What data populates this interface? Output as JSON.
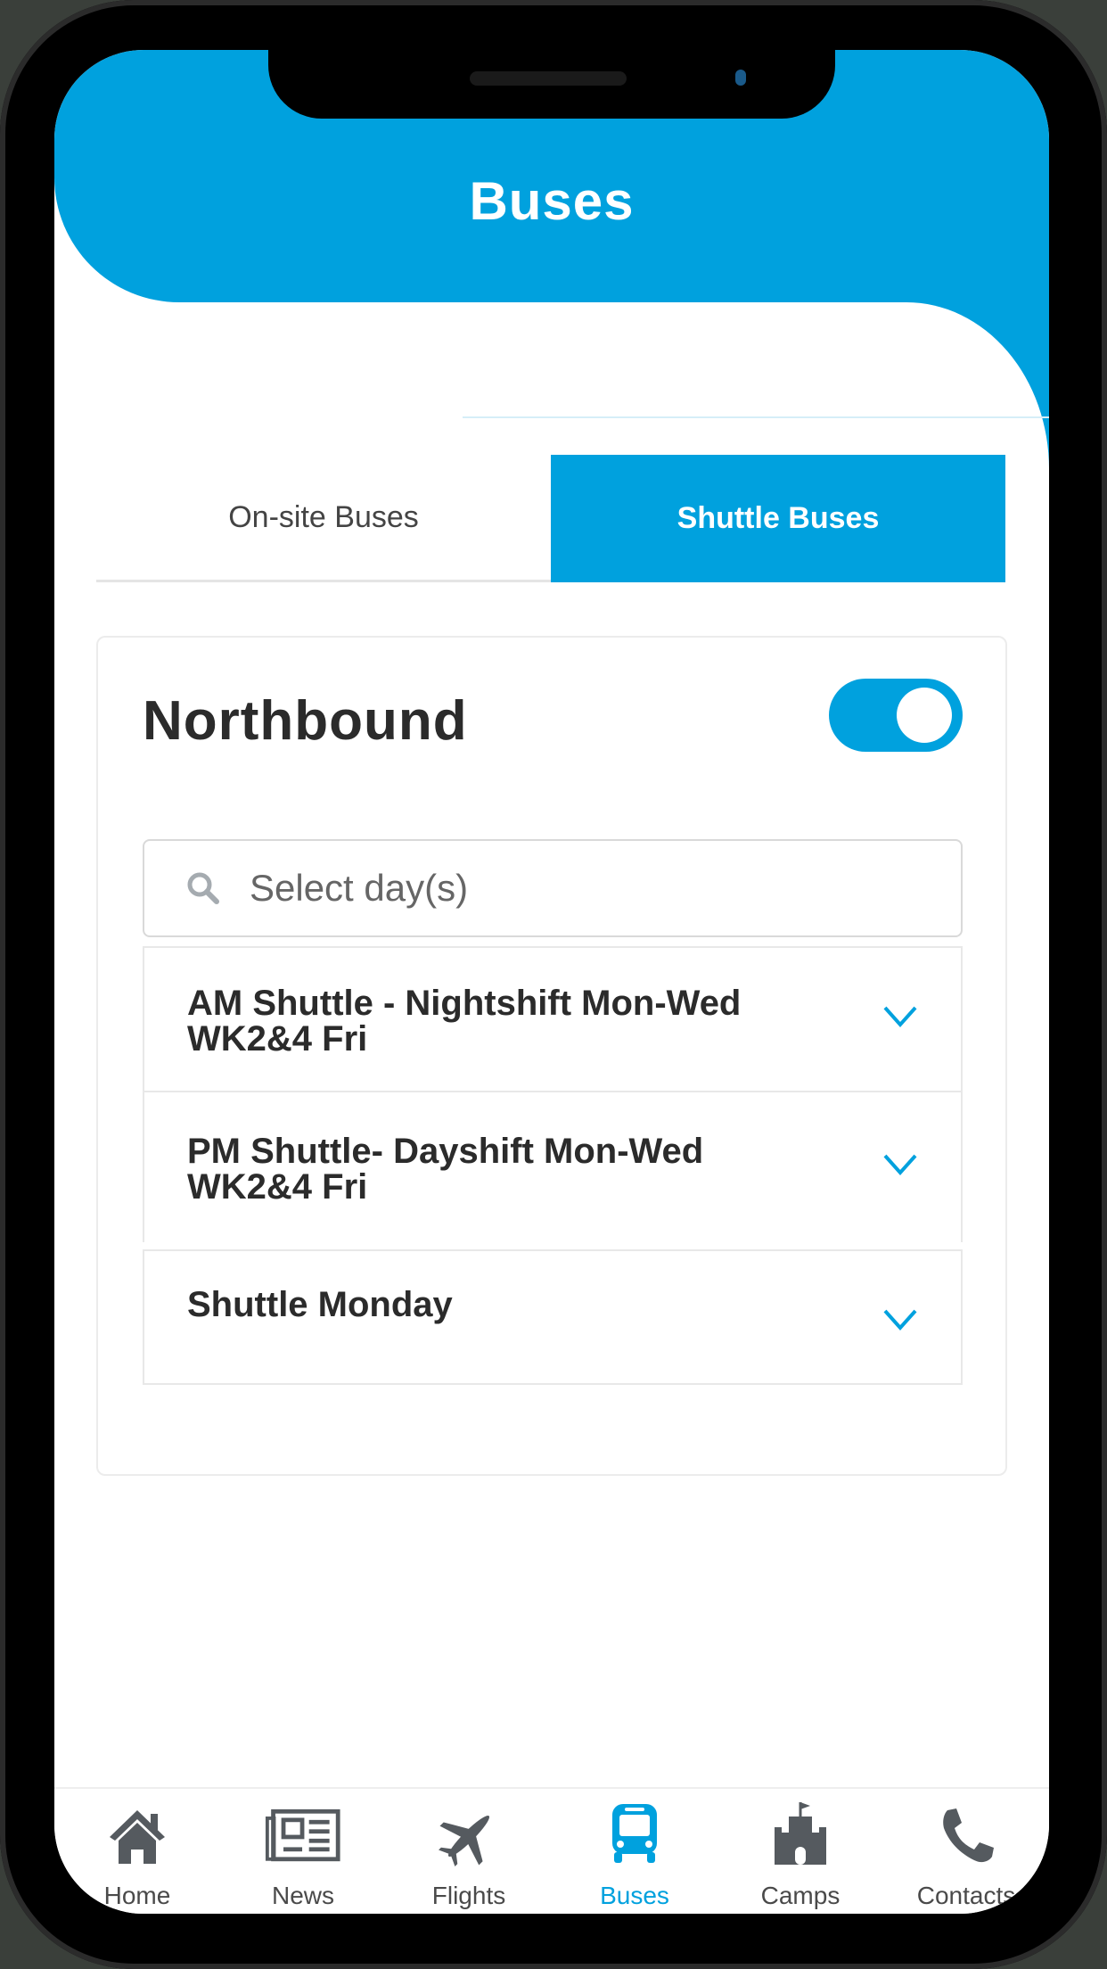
{
  "header": {
    "title": "Buses"
  },
  "tabs": [
    {
      "label": "On-site Buses",
      "active": false
    },
    {
      "label": "Shuttle Buses",
      "active": true
    }
  ],
  "section": {
    "direction_label": "Northbound",
    "direction_toggle_on": true,
    "search": {
      "placeholder": "Select day(s)",
      "value": ""
    },
    "items": [
      {
        "label": "AM Shuttle - Nightshift   Mon-Wed WK2&4 Fri"
      },
      {
        "label": "PM Shuttle- Dayshift  Mon-Wed WK2&4 Fri"
      },
      {
        "label": "Shuttle Monday"
      }
    ]
  },
  "bottom_nav": [
    {
      "label": "Home",
      "icon": "home-icon",
      "active": false
    },
    {
      "label": "News",
      "icon": "newspaper-icon",
      "active": false
    },
    {
      "label": "Flights",
      "icon": "plane-icon",
      "active": false
    },
    {
      "label": "Buses",
      "icon": "bus-icon",
      "active": true
    },
    {
      "label": "Camps",
      "icon": "castle-icon",
      "active": false
    },
    {
      "label": "Contacts",
      "icon": "phone-icon",
      "active": false
    }
  ],
  "colors": {
    "accent": "#00a1de",
    "text": "#2b2b2b",
    "icon_gray": "#555a5f"
  }
}
